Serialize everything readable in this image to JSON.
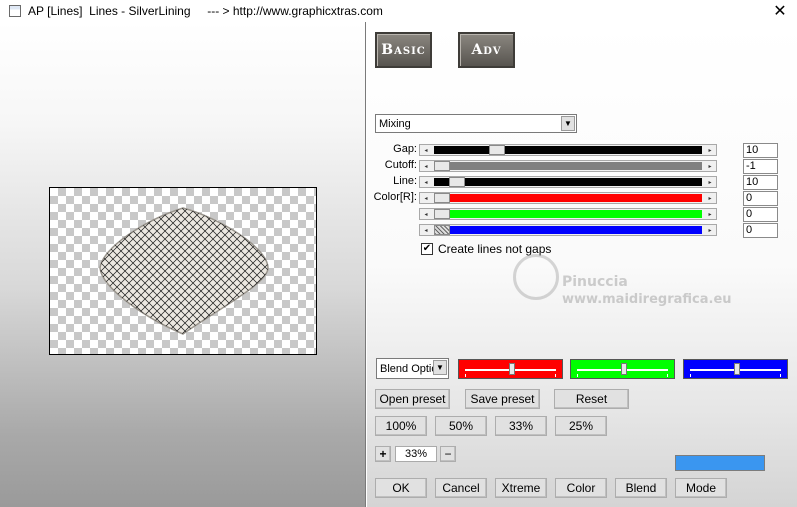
{
  "window": {
    "title": "AP [Lines]  Lines - SilverLining     --- > http://www.graphicxtras.com",
    "close_glyph": "✕"
  },
  "tabs": {
    "basic": "Basic",
    "adv": "Adv"
  },
  "mode_select": {
    "value": "Mixing"
  },
  "sliders": [
    {
      "label": "Gap:",
      "value": "10",
      "position": 0.22,
      "track_color": "#000000"
    },
    {
      "label": "Cutoff:",
      "value": "-1",
      "position": 0.0,
      "track_color": "#808080"
    },
    {
      "label": "Line:",
      "value": "10",
      "position": 0.06,
      "track_color": "#000000"
    },
    {
      "label": "Color[R]:",
      "value": "0",
      "position": 0.0,
      "track_color": "#ff0000"
    },
    {
      "label": "",
      "value": "0",
      "position": 0.0,
      "track_color": "#00ff00"
    },
    {
      "label": "",
      "value": "0",
      "position": 0.0,
      "track_color": "#0000ff"
    }
  ],
  "checkbox": {
    "label": "Create lines not gaps",
    "checked": true
  },
  "watermark": {
    "line1": "Pinuccia",
    "line2": "www.maidiregrafica.eu"
  },
  "blend_select": {
    "value": "Blend Optio"
  },
  "rgb_sliders": [
    {
      "color": "#ff0000",
      "position": 0.5
    },
    {
      "color": "#00ff00",
      "position": 0.5
    },
    {
      "color": "#0000ff",
      "position": 0.5
    }
  ],
  "preset_buttons": {
    "open": "Open preset",
    "save": "Save preset",
    "reset": "Reset"
  },
  "zoom_buttons": [
    "100%",
    "50%",
    "33%",
    "25%"
  ],
  "zoom_stepper": {
    "plus": "+",
    "value": "33%",
    "minus": "−"
  },
  "output_color": "#3a96f0",
  "bottom_buttons": [
    "OK",
    "Cancel",
    "Xtreme",
    "Color",
    "Blend",
    "Mode"
  ]
}
